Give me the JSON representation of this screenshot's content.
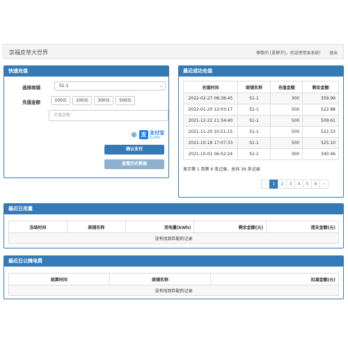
{
  "header": {
    "brand": "崇福皮草大世界",
    "welcome": "尊敬的 [夏薛芬]，欢迎使用本系统!",
    "logout": "退出"
  },
  "quick_recharge": {
    "title": "快速充值",
    "shop_label": "选择商铺",
    "shop_selected": "S1-1",
    "amount_label": "充值金额",
    "amount_options": [
      "100元",
      "200元",
      "300元",
      "500元"
    ],
    "amount_placeholder": "充值金额",
    "payment": {
      "name": "支付宝",
      "sub": "ALIPAY",
      "icon": "alipay-icon",
      "color": "#1677ff"
    },
    "confirm_label": "确认支付",
    "history_label": "查看历史数据"
  },
  "recent_recharge": {
    "title": "最近成功充值",
    "columns": [
      "充值时间",
      "商铺名称",
      "充值金额",
      "剩余金额"
    ],
    "rows": [
      [
        "2022-02-27 08:38:45",
        "S1-1",
        "300",
        "359.99"
      ],
      [
        "2022-01-20 12:03:17",
        "S1-1",
        "500",
        "522.88"
      ],
      [
        "2021-12-22 11:34:40",
        "S1-1",
        "500",
        "509.61"
      ],
      [
        "2021-11-20 10:51:15",
        "S1-1",
        "500",
        "522.53"
      ],
      [
        "2021-10-18 17:07:33",
        "S1-1",
        "500",
        "525.10"
      ],
      [
        "2021-10-01 06:02:24",
        "S1-1",
        "300",
        "340.46"
      ]
    ],
    "records_info": "显示第 1 到第 6 条记录，总共 36 条记录",
    "pager": [
      "‹",
      "1",
      "2",
      "3",
      "4",
      "5",
      "6",
      "›"
    ],
    "current_page": "1"
  },
  "daily_usage": {
    "title": "最近日用量",
    "columns": [
      "冻结时间",
      "商铺名称",
      "用电量(kWh)",
      "剩余金额(元)",
      "透支金额(元)"
    ],
    "empty_text": "没有找到匹配的记录"
  },
  "shared_fee": {
    "title": "最近日公摊电费",
    "columns": [
      "结算时间",
      "商铺名称",
      "扣减金额(元)"
    ],
    "empty_text": "没有找到匹配的记录"
  },
  "colors": {
    "primary": "#337ab7",
    "secondary_button": "#8fb0cf"
  }
}
